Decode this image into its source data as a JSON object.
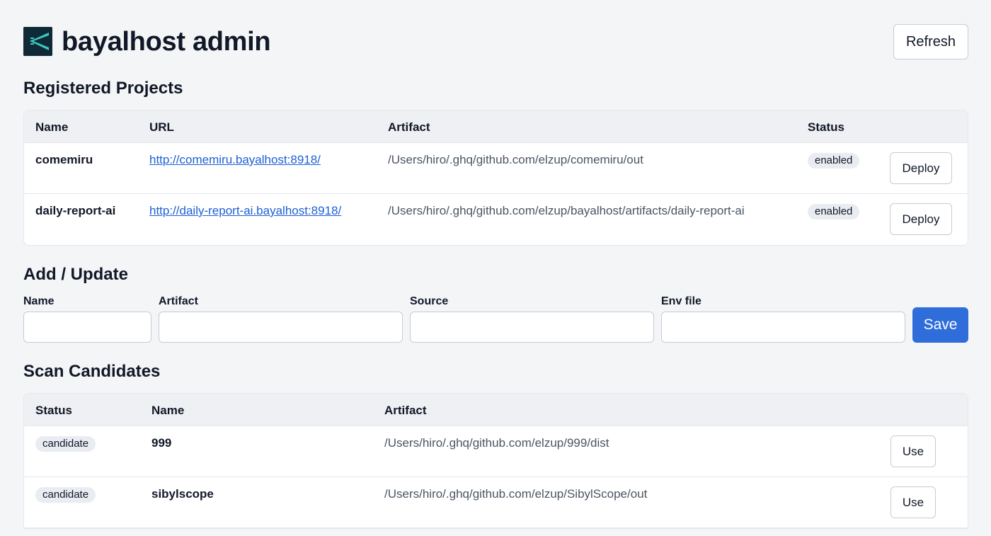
{
  "header": {
    "title": "bayalhost admin",
    "refresh_label": "Refresh"
  },
  "projects": {
    "title": "Registered Projects",
    "columns": [
      "Name",
      "URL",
      "Artifact",
      "Status"
    ],
    "rows": [
      {
        "name": "comemiru",
        "url": "http://comemiru.bayalhost:8918/",
        "artifact": "/Users/hiro/.ghq/github.com/elzup/comemiru/out",
        "status": "enabled",
        "action": "Deploy"
      },
      {
        "name": "daily-report-ai",
        "url": "http://daily-report-ai.bayalhost:8918/",
        "artifact": "/Users/hiro/.ghq/github.com/elzup/bayalhost/artifacts/daily-report-ai",
        "status": "enabled",
        "action": "Deploy"
      }
    ]
  },
  "form": {
    "title": "Add / Update",
    "name_label": "Name",
    "artifact_label": "Artifact",
    "source_label": "Source",
    "env_label": "Env file",
    "name_value": "",
    "artifact_value": "",
    "source_value": "",
    "env_value": "",
    "save_label": "Save"
  },
  "candidates": {
    "title": "Scan Candidates",
    "columns": [
      "Status",
      "Name",
      "Artifact"
    ],
    "rows": [
      {
        "status": "candidate",
        "name": "999",
        "artifact": "/Users/hiro/.ghq/github.com/elzup/999/dist",
        "action": "Use"
      },
      {
        "status": "candidate",
        "name": "sibylscope",
        "artifact": "/Users/hiro/.ghq/github.com/elzup/SibylScope/out",
        "action": "Use"
      }
    ]
  },
  "colors": {
    "background": "#f4f5f7",
    "primary": "#2f6ddb",
    "link": "#1d5fd6",
    "logo_bg": "#0f2a36",
    "logo_accent": "#3fc7c2"
  }
}
